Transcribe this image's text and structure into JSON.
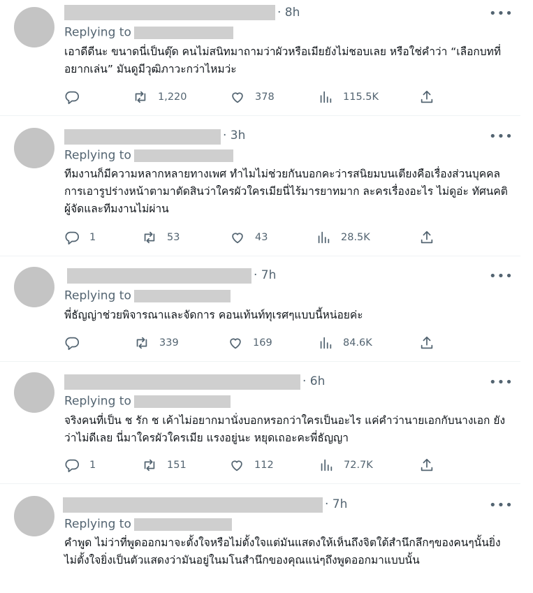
{
  "labels": {
    "replying_to": "Replying to",
    "more": "•••"
  },
  "tweets": [
    {
      "time": "· 8h",
      "text": "เอาดีดีนะ ขนาดนี่เป็นตุ๊ด คนไม่สนิทมาถามว่าผัวหรือเมียยังไม่ชอบเลย หรือใช่คำว่า “เลือกบทที่อยากเล่น” มันดูมีวุฒิภาวะกว่าไหมว่ะ",
      "replies": "",
      "reposts": "1,220",
      "likes": "378",
      "views": "115.5K"
    },
    {
      "time": "· 3h",
      "text": "ทีมงานก็มีความหลากหลายทางเพศ ทำไมไม่ช่วยกันบอกคะว่ารสนิยมบนเตียงคือเรื่องส่วนบุคคล การเอารูปร่างหน้าตามาตัดสินว่าใครผัวใครเมียนี่ไร้มารยาทมาก ละครเรื่องอะไร ไม่ดูอ่ะ ทัศนคติผู้จัดและทีมงานไม่ผ่าน",
      "replies": "1",
      "reposts": "53",
      "likes": "43",
      "views": "28.5K"
    },
    {
      "time": "· 7h",
      "text": "พี่ธัญญ่าช่วยพิจารณาและจัดการ คอนเท้นท์ทุเรศๆแบบนี้หน่อยค่ะ",
      "replies": "",
      "reposts": "339",
      "likes": "169",
      "views": "84.6K"
    },
    {
      "time": "· 6h",
      "text": "จริงคนที่เป็น ช รัก ช เค้าไม่อยากมานั่งบอกหรอกว่าใครเป็นอะไร แค่คำว่านายเอกกับนางเอก ยังว่าไม่ดีเลย นี่มาใครผัวใครเมีย แรงอยู่นะ หยุดเถอะคะพี่ธัญญา",
      "replies": "1",
      "reposts": "151",
      "likes": "112",
      "views": "72.7K"
    },
    {
      "time": "· 7h",
      "text": "คำพูด ไม่ว่าที่พูดออกมาจะตั้งใจหรือไม่ตั้งใจแต่มันแสดงให้เห็นถึงจิตใต้สำนึกลึกๆของคนๆนั้นยิ่งไม่ตั้งใจยิ่งเป็นตัวแสดงว่ามันอยู่ในมโนสำนึกของคุณแน่ๆถึงพูดออกมาแบบนั้น",
      "replies": "",
      "reposts": "",
      "likes": "",
      "views": ""
    }
  ],
  "colors": {
    "muted": "#536471",
    "text": "#0f1419",
    "placeholder": "#cfcfcf",
    "avatar": "#c4c4c4",
    "divider": "#eff3f4"
  }
}
